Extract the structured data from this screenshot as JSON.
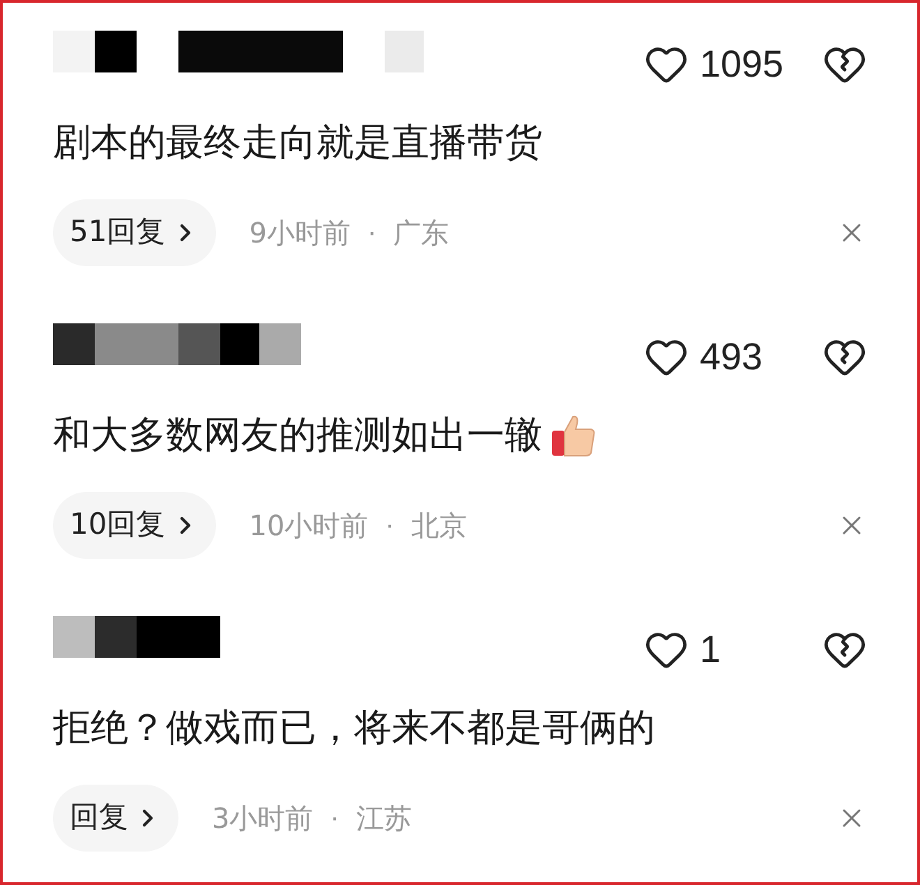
{
  "comments": [
    {
      "likes": "1095",
      "text": "剧本的最终走向就是直播带货",
      "emoji": false,
      "replies": "51回复",
      "time": "9小时前",
      "separator": "·",
      "location": "广东"
    },
    {
      "likes": "493",
      "text": "和大多数网友的推测如出一辙",
      "emoji": true,
      "replies": "10回复",
      "time": "10小时前",
      "separator": "·",
      "location": "北京"
    },
    {
      "likes": "1",
      "text": "拒绝？做戏而已，将来不都是哥俩的",
      "emoji": false,
      "replies": "回复",
      "time": "3小时前",
      "separator": "·",
      "location": "江苏"
    }
  ]
}
